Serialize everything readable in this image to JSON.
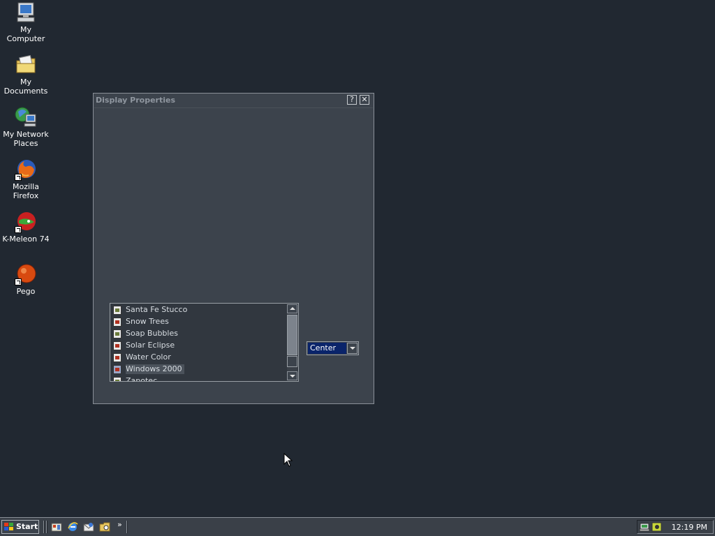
{
  "desktop": {
    "icons": [
      {
        "label": "My Computer"
      },
      {
        "label": "My Documents"
      },
      {
        "label": "My Network Places"
      },
      {
        "label": "Mozilla Firefox"
      },
      {
        "label": "K-Meleon 74"
      },
      {
        "label": "Pego"
      }
    ]
  },
  "dialog": {
    "title": "Display Properties",
    "help_btn": "?",
    "close_btn": "✕",
    "wallpaper_list": [
      {
        "label": "Santa Fe Stucco"
      },
      {
        "label": "Snow Trees"
      },
      {
        "label": "Soap Bubbles"
      },
      {
        "label": "Solar Eclipse"
      },
      {
        "label": "Water Color"
      },
      {
        "label": "Windows 2000",
        "selected": true
      },
      {
        "label": "Zapotec"
      }
    ],
    "position_select": {
      "value": "Center"
    }
  },
  "taskbar": {
    "start_label": "Start",
    "more_glyph": "»",
    "clock": "12:19 PM"
  },
  "colors": {
    "desktop_bg": "#212831",
    "window_bg": "#3c434c",
    "selection": "#0a246a"
  }
}
